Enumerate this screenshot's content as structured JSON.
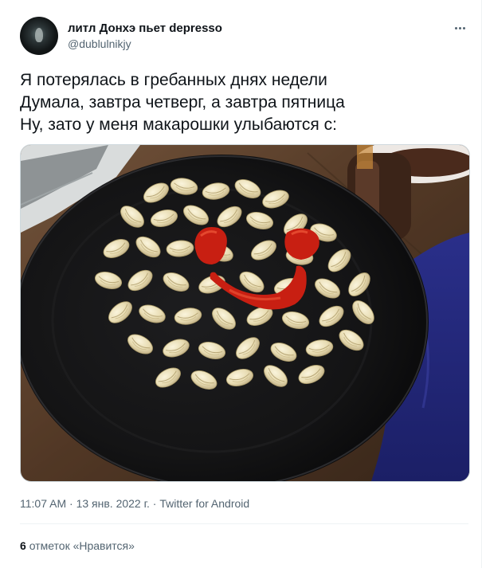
{
  "user": {
    "display_name": "литл Донхэ пьет depresso",
    "handle": "@dublulnikjy"
  },
  "tweet": {
    "lines": [
      "Я потерялась в гребанных днях недели",
      "Думала, завтра четверг, а завтра пятница",
      "Ну, зато у меня макарошки улыбаются с:"
    ],
    "time": "11:07 AM",
    "date": "13 янв. 2022 г.",
    "source": "Twitter for Android",
    "separator": "·"
  },
  "likes": {
    "count": "6",
    "label": "отметок «Нравится»"
  },
  "icons": {
    "more": "more-options-icon",
    "avatar": "user-avatar"
  },
  "colors": {
    "text": "#0f1419",
    "secondary": "#536471",
    "divider": "#eff3f4"
  }
}
